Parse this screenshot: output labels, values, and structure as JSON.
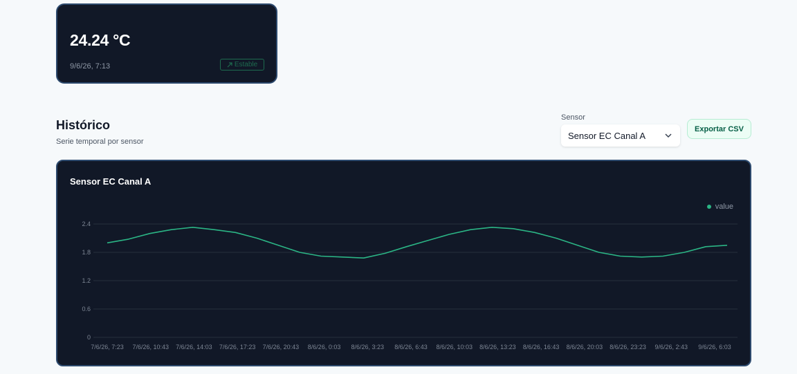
{
  "temperature_card": {
    "value": "24.24 °C",
    "timestamp": "9/6/26, 7:13",
    "badge_label": "Estable",
    "badge_icon": "arrow-up-right-icon"
  },
  "historico": {
    "title": "Histórico",
    "subtitle": "Serie temporal por sensor",
    "sensor_label": "Sensor",
    "sensor_selected": "Sensor EC Canal A",
    "export_label": "Exportar CSV"
  },
  "colors": {
    "line": "#2bb585",
    "card_bg": "#111827",
    "card_border": "#2d4a6e"
  },
  "chart": {
    "title": "Sensor EC Canal A",
    "legend": "value"
  },
  "chart_data": {
    "type": "line",
    "title": "Sensor EC Canal A",
    "ylim": [
      0,
      2.4
    ],
    "yticks": [
      "0",
      "0.6",
      "1.2",
      "1.8",
      "2.4"
    ],
    "x_ticks": [
      "7/6/26, 7:23",
      "7/6/26, 10:43",
      "7/6/26, 14:03",
      "7/6/26, 17:23",
      "7/6/26, 20:43",
      "8/6/26, 0:03",
      "8/6/26, 3:23",
      "8/6/26, 6:43",
      "8/6/26, 10:03",
      "8/6/26, 13:23",
      "8/6/26, 16:43",
      "8/6/26, 20:03",
      "8/6/26, 23:23",
      "9/6/26, 2:43",
      "9/6/26, 6:03"
    ],
    "grid": true,
    "legend_position": "top-right",
    "series": [
      {
        "name": "value",
        "x": [
          "7/6/26, 7:23",
          "7/6/26, 9:03",
          "7/6/26, 10:43",
          "7/6/26, 12:23",
          "7/6/26, 14:03",
          "7/6/26, 15:43",
          "7/6/26, 17:23",
          "7/6/26, 19:03",
          "7/6/26, 20:43",
          "7/6/26, 22:23",
          "8/6/26, 0:03",
          "8/6/26, 1:43",
          "8/6/26, 3:23",
          "8/6/26, 5:03",
          "8/6/26, 6:43",
          "8/6/26, 8:23",
          "8/6/26, 10:03",
          "8/6/26, 11:43",
          "8/6/26, 13:23",
          "8/6/26, 15:03",
          "8/6/26, 16:43",
          "8/6/26, 18:23",
          "8/6/26, 20:03",
          "8/6/26, 21:43",
          "8/6/26, 23:23",
          "9/6/26, 1:03",
          "9/6/26, 2:43",
          "9/6/26, 4:23",
          "9/6/26, 6:03",
          "9/6/26, 7:13"
        ],
        "values": [
          2.0,
          2.08,
          2.2,
          2.28,
          2.33,
          2.28,
          2.22,
          2.1,
          1.95,
          1.8,
          1.72,
          1.7,
          1.68,
          1.78,
          1.92,
          2.05,
          2.18,
          2.28,
          2.33,
          2.3,
          2.22,
          2.1,
          1.95,
          1.8,
          1.72,
          1.7,
          1.72,
          1.8,
          1.92,
          1.95
        ]
      }
    ]
  }
}
